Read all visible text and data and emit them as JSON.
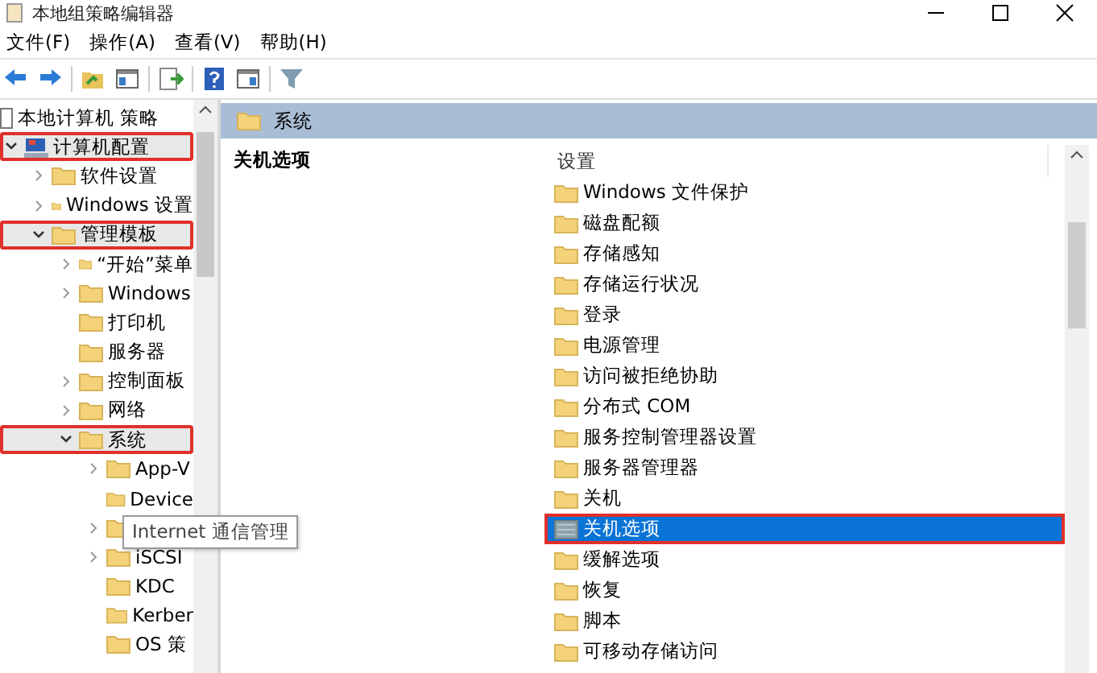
{
  "window": {
    "title": "本地组策略编辑器"
  },
  "menu": [
    "文件(F)",
    "操作(A)",
    "查看(V)",
    "帮助(H)"
  ],
  "toolbar": [
    {
      "kind": "back"
    },
    {
      "kind": "forward"
    },
    {
      "kind": "sep"
    },
    {
      "kind": "up-folder"
    },
    {
      "kind": "console-tree"
    },
    {
      "kind": "sep"
    },
    {
      "kind": "export"
    },
    {
      "kind": "sep"
    },
    {
      "kind": "help"
    },
    {
      "kind": "panel"
    },
    {
      "kind": "sep"
    },
    {
      "kind": "filter"
    }
  ],
  "tree": [
    {
      "label": "本地计算机 策略",
      "kind": "policy",
      "annotated": false,
      "children": [
        {
          "label": "计算机配置",
          "kind": "computer",
          "expanded": true,
          "annotated": true,
          "children": [
            {
              "label": "软件设置",
              "kind": "folder",
              "expanded": false,
              "annotated": false
            },
            {
              "label": "Windows 设置",
              "kind": "folder",
              "expanded": false,
              "annotated": false
            },
            {
              "label": "管理模板",
              "kind": "folder",
              "expanded": true,
              "annotated": true,
              "children": [
                {
                  "label": "“开始”菜单",
                  "kind": "folder",
                  "expanded": false,
                  "annotated": false
                },
                {
                  "label": "Windows",
                  "kind": "folder",
                  "expanded": false,
                  "annotated": false
                },
                {
                  "label": "打印机",
                  "kind": "folder",
                  "annotated": false
                },
                {
                  "label": "服务器",
                  "kind": "folder",
                  "annotated": false
                },
                {
                  "label": "控制面板",
                  "kind": "folder",
                  "expanded": false,
                  "annotated": false
                },
                {
                  "label": "网络",
                  "kind": "folder",
                  "expanded": false,
                  "annotated": false
                },
                {
                  "label": "系统",
                  "kind": "folder",
                  "expanded": true,
                  "annotated": true,
                  "children": [
                    {
                      "label": "App-V",
                      "kind": "folder",
                      "expanded": false,
                      "annotated": false
                    },
                    {
                      "label": "Device",
                      "kind": "folder",
                      "annotated": false
                    },
                    {
                      "kind": "folder",
                      "expanded": false,
                      "annotated": false
                    },
                    {
                      "label": "iSCSI",
                      "kind": "folder",
                      "expanded": false,
                      "annotated": false
                    },
                    {
                      "label": "KDC",
                      "kind": "folder",
                      "annotated": false
                    },
                    {
                      "label": "Kerber",
                      "kind": "folder",
                      "annotated": false
                    },
                    {
                      "label": "OS 策",
                      "kind": "folder",
                      "annotated": false
                    }
                  ]
                }
              ]
            }
          ]
        }
      ]
    }
  ],
  "tooltip": "Internet 通信管理",
  "header": {
    "title": "系统"
  },
  "description": {
    "title": "关机选项"
  },
  "settings": {
    "column": "设置",
    "items": [
      {
        "label": "Windows 文件保护",
        "kind": "folder",
        "selected": false,
        "annotated": false
      },
      {
        "label": "磁盘配额",
        "kind": "folder",
        "selected": false,
        "annotated": false
      },
      {
        "label": "存储感知",
        "kind": "folder",
        "selected": false,
        "annotated": false
      },
      {
        "label": "存储运行状况",
        "kind": "folder",
        "selected": false,
        "annotated": false
      },
      {
        "label": "登录",
        "kind": "folder",
        "selected": false,
        "annotated": false
      },
      {
        "label": "电源管理",
        "kind": "folder",
        "selected": false,
        "annotated": false
      },
      {
        "label": "访问被拒绝协助",
        "kind": "folder",
        "selected": false,
        "annotated": false
      },
      {
        "label": "分布式 COM",
        "kind": "folder",
        "selected": false,
        "annotated": false
      },
      {
        "label": "服务控制管理器设置",
        "kind": "folder",
        "selected": false,
        "annotated": false
      },
      {
        "label": "服务器管理器",
        "kind": "folder",
        "selected": false,
        "annotated": false
      },
      {
        "label": "关机",
        "kind": "folder",
        "selected": false,
        "annotated": false
      },
      {
        "label": "关机选项",
        "kind": "folder",
        "selected": true,
        "annotated": true
      },
      {
        "label": "缓解选项",
        "kind": "folder",
        "selected": false,
        "annotated": false
      },
      {
        "label": "恢复",
        "kind": "folder",
        "selected": false,
        "annotated": false
      },
      {
        "label": "脚本",
        "kind": "folder",
        "selected": false,
        "annotated": false
      },
      {
        "label": "可移动存储访问",
        "kind": "folder",
        "selected": false,
        "annotated": false
      }
    ]
  }
}
